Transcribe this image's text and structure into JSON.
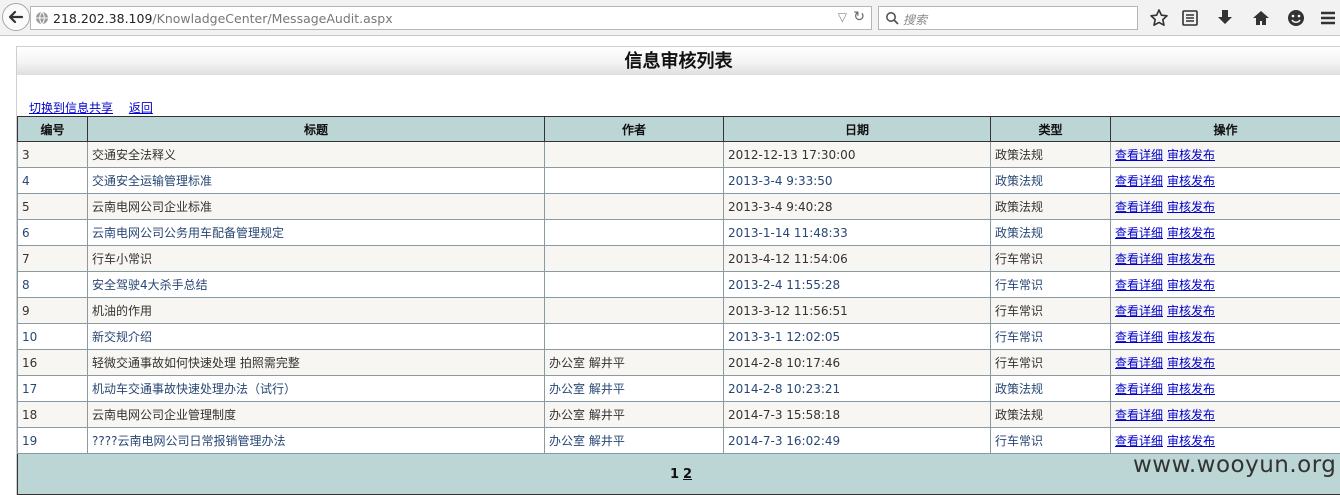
{
  "browser": {
    "url_host": "218.202.38.109",
    "url_path": "/KnowladgeCenter/MessageAudit.aspx",
    "search_placeholder": "搜索"
  },
  "page": {
    "title": "信息审核列表",
    "links": [
      "切换到信息共享",
      "返回"
    ]
  },
  "table": {
    "headers": [
      "编号",
      "标题",
      "作者",
      "日期",
      "类型",
      "操作"
    ],
    "action_labels": [
      "查看详细",
      "审核发布"
    ],
    "rows": [
      {
        "id": "3",
        "title": "交通安全法释义",
        "author": "",
        "date": "2012-12-13 17:30:00",
        "type": "政策法规"
      },
      {
        "id": "4",
        "title": "交通安全运输管理标准",
        "author": "",
        "date": "2013-3-4 9:33:50",
        "type": "政策法规"
      },
      {
        "id": "5",
        "title": "云南电网公司企业标准",
        "author": "",
        "date": "2013-3-4 9:40:28",
        "type": "政策法规"
      },
      {
        "id": "6",
        "title": "云南电网公司公务用车配备管理规定",
        "author": "",
        "date": "2013-1-14 11:48:33",
        "type": "政策法规"
      },
      {
        "id": "7",
        "title": "行车小常识",
        "author": "",
        "date": "2013-4-12 11:54:06",
        "type": "行车常识"
      },
      {
        "id": "8",
        "title": "安全驾驶4大杀手总结",
        "author": "",
        "date": "2013-2-4 11:55:28",
        "type": "行车常识"
      },
      {
        "id": "9",
        "title": "机油的作用",
        "author": "",
        "date": "2013-3-12 11:56:51",
        "type": "行车常识"
      },
      {
        "id": "10",
        "title": "新交规介绍",
        "author": "",
        "date": "2013-3-1 12:02:05",
        "type": "行车常识"
      },
      {
        "id": "16",
        "title": "轻微交通事故如何快速处理 拍照需完整",
        "author": "办公室 解井平",
        "date": "2014-2-8 10:17:46",
        "type": "行车常识"
      },
      {
        "id": "17",
        "title": "机动车交通事故快速处理办法（试行）",
        "author": "办公室 解井平",
        "date": "2014-2-8 10:23:21",
        "type": "政策法规"
      },
      {
        "id": "18",
        "title": "云南电网公司企业管理制度",
        "author": "办公室 解井平",
        "date": "2014-7-3 15:58:18",
        "type": "政策法规"
      },
      {
        "id": "19",
        "title": "????云南电网公司日常报销管理办法",
        "author": "办公室 解井平",
        "date": "2014-7-3 16:02:49",
        "type": "行车常识"
      }
    ],
    "pager": {
      "current": "1",
      "pages": [
        "2"
      ]
    }
  },
  "watermark": "www.wooyun.org",
  "icons": [
    "back-arrow-icon",
    "globe-icon",
    "dropdown-arrow-icon",
    "reload-icon",
    "search-icon",
    "bookmark-star-icon",
    "reading-list-icon",
    "download-icon",
    "home-icon",
    "smiley-icon",
    "menu-icon"
  ]
}
